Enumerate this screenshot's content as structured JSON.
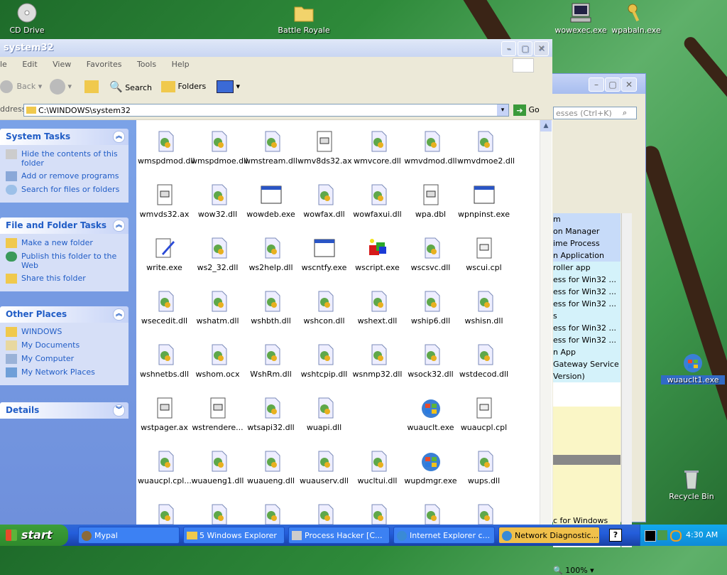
{
  "desktop": {
    "icons": [
      {
        "label": "CD Drive",
        "icon": "cd-drive-icon"
      },
      {
        "label": "Battle Royale",
        "icon": "folder-icon"
      },
      {
        "label": "wowexec.exe",
        "icon": "computer-icon"
      },
      {
        "label": "wpabaln.exe",
        "icon": "keys-icon"
      },
      {
        "label": "wuauclt1.exe",
        "icon": "windows-update-icon"
      },
      {
        "label": "Recycle Bin",
        "icon": "recycle-bin-icon"
      }
    ]
  },
  "process_hacker": {
    "search_placeholder": "esses (Ctrl+K)",
    "rows": [
      "m",
      "on Manager",
      "ime Process",
      "n Application",
      "roller app",
      "ess for Win32 ...",
      "ess for Win32 ...",
      "ess for Win32 ...",
      "s",
      "ess for Win32 ...",
      "ess for Win32 ...",
      "n App",
      "Gateway Service",
      "Version)",
      "",
      "",
      "",
      "",
      "",
      "",
      "",
      "",
      "",
      "c for Windows"
    ],
    "zoom": "100%"
  },
  "explorer": {
    "title": "system32",
    "menu": [
      "le",
      "Edit",
      "View",
      "Favorites",
      "Tools",
      "Help"
    ],
    "toolbar": {
      "back": "Back",
      "search": "Search",
      "folders": "Folders"
    },
    "address_label": "ddress",
    "address_value": "C:\\WINDOWS\\system32",
    "go_label": "Go",
    "system_tasks": {
      "title": "System Tasks",
      "items": [
        "Hide the contents of this folder",
        "Add or remove programs",
        "Search for files or folders"
      ]
    },
    "file_folder_tasks": {
      "title": "File and Folder Tasks",
      "items": [
        "Make a new folder",
        "Publish this folder to the Web",
        "Share this folder"
      ]
    },
    "other_places": {
      "title": "Other Places",
      "items": [
        "WINDOWS",
        "My Documents",
        "My Computer",
        "My Network Places"
      ]
    },
    "details": {
      "title": "Details"
    },
    "files": [
      "wmspdmod.dll",
      "wmspdmoe.dll",
      "wmstream.dll",
      "wmv8ds32.ax",
      "wmvcore.dll",
      "wmvdmod.dll",
      "wmvdmoe2.dll",
      "wmvds32.ax",
      "wow32.dll",
      "wowdeb.exe",
      "wowfax.dll",
      "wowfaxui.dll",
      "wpa.dbl",
      "wpnpinst.exe",
      "write.exe",
      "ws2_32.dll",
      "ws2help.dll",
      "wscntfy.exe",
      "wscript.exe",
      "wscsvc.dll",
      "wscui.cpl",
      "wsecedit.dll",
      "wshatm.dll",
      "wshbth.dll",
      "wshcon.dll",
      "wshext.dll",
      "wship6.dll",
      "wshisn.dll",
      "wshnetbs.dll",
      "wshom.ocx",
      "WshRm.dll",
      "wshtcpip.dll",
      "wsnmp32.dll",
      "wsock32.dll",
      "wstdecod.dll",
      "wstpager.ax",
      "wstrendere...",
      "wtsapi32.dll",
      "wuapi.dll",
      "",
      "wuauclt.exe",
      "wuaucpl.cpl",
      "wuaucpl.cpl...",
      "wuaueng1.dll",
      "wuaueng.dll",
      "wuauserv.dll",
      "wucltui.dll",
      "wupdmgr.exe",
      "wups.dll",
      "",
      "",
      "",
      "",
      "",
      "",
      ""
    ]
  },
  "taskbar": {
    "start": "start",
    "tasks": [
      "Mypal",
      "5 Windows Explorer",
      "Process Hacker [C...",
      "Internet Explorer c...",
      "Network Diagnostic..."
    ],
    "time": "4:30 AM"
  }
}
